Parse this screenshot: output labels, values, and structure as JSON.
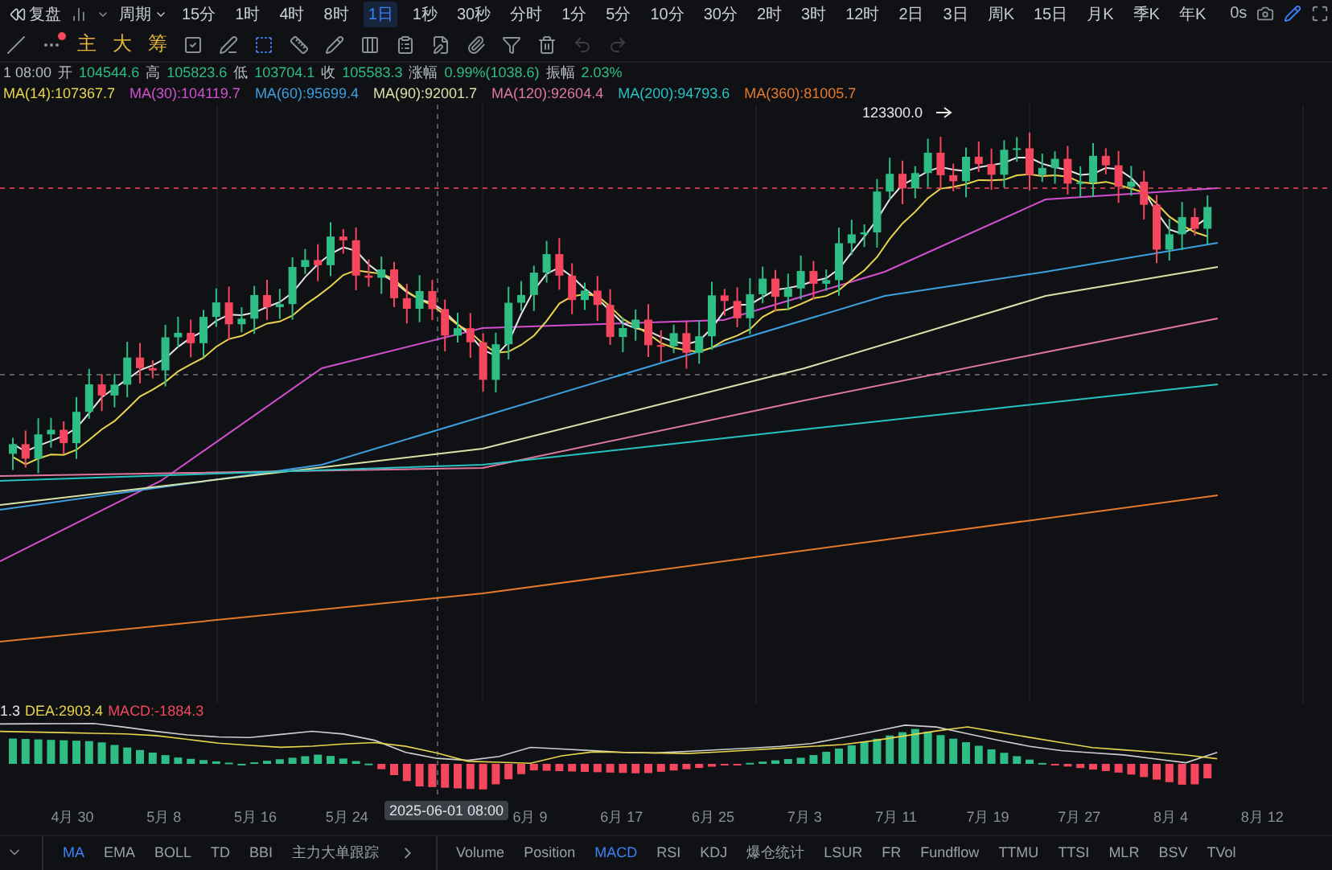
{
  "toolbar": {
    "replay": "复盘",
    "period_menu": "周期",
    "periods": [
      {
        "label": "15分",
        "selected": false
      },
      {
        "label": "1时",
        "selected": false
      },
      {
        "label": "4时",
        "selected": false
      },
      {
        "label": "8时",
        "selected": false
      },
      {
        "label": "1日",
        "selected": true
      },
      {
        "label": "1秒",
        "selected": false
      },
      {
        "label": "30秒",
        "selected": false
      },
      {
        "label": "分时",
        "selected": false
      },
      {
        "label": "1分",
        "selected": false
      },
      {
        "label": "5分",
        "selected": false
      },
      {
        "label": "10分",
        "selected": false
      },
      {
        "label": "30分",
        "selected": false
      },
      {
        "label": "2时",
        "selected": false
      },
      {
        "label": "3时",
        "selected": false
      },
      {
        "label": "12时",
        "selected": false
      },
      {
        "label": "2日",
        "selected": false
      },
      {
        "label": "3日",
        "selected": false
      },
      {
        "label": "周K",
        "selected": false
      },
      {
        "label": "15日",
        "selected": false
      },
      {
        "label": "月K",
        "selected": false
      },
      {
        "label": "季K",
        "selected": false
      },
      {
        "label": "年K",
        "selected": false
      }
    ],
    "countdown": "0s"
  },
  "quick_buttons": [
    "主",
    "大",
    "筹"
  ],
  "ohlc_info": {
    "time": "1 08:00",
    "fields": [
      {
        "label": "开",
        "value": "104544.6"
      },
      {
        "label": "高",
        "value": "105823.6"
      },
      {
        "label": "低",
        "value": "103704.1"
      },
      {
        "label": "收",
        "value": "105583.3"
      },
      {
        "label": "涨幅",
        "value": "0.99%(1038.6)"
      },
      {
        "label": "振幅",
        "value": "2.03%"
      }
    ]
  },
  "ma_legend": [
    {
      "text": "MA(14):107367.7",
      "color": "#e8d44d"
    },
    {
      "text": "MA(30):104119.7",
      "color": "#d24fd0"
    },
    {
      "text": "MA(60):95699.4",
      "color": "#3d9fe0"
    },
    {
      "text": "MA(90):92001.7",
      "color": "#d6e2a6"
    },
    {
      "text": "MA(120):92604.4",
      "color": "#e0789e"
    },
    {
      "text": "MA(200):94793.6",
      "color": "#27c2c2"
    },
    {
      "text": "MA(360):81005.7",
      "color": "#e5792c"
    }
  ],
  "chart": {
    "high_marker": "123300.0",
    "crosshair_time": "2025-06-01 08:00",
    "x_labels": [
      "4月 30",
      "5月 8",
      "5月 16",
      "5月 24",
      "6月 9",
      "6月 17",
      "6月 25",
      "7月 3",
      "7月 11",
      "7月 19",
      "7月 27",
      "8月 4",
      "8月 12"
    ]
  },
  "macd_legend": [
    {
      "text": "1.3",
      "color": "#e6e6e6"
    },
    {
      "text": "DEA:2903.4",
      "color": "#e8d44d"
    },
    {
      "text": "MACD:-1884.3",
      "color": "#f6465d"
    }
  ],
  "main_indicators": [
    {
      "label": "MA",
      "selected": true
    },
    {
      "label": "EMA",
      "selected": false
    },
    {
      "label": "BOLL",
      "selected": false
    },
    {
      "label": "TD",
      "selected": false
    },
    {
      "label": "BBI",
      "selected": false
    },
    {
      "label": "主力大单跟踪",
      "selected": false
    }
  ],
  "sub_indicators": [
    {
      "label": "Volume",
      "selected": false
    },
    {
      "label": "Position",
      "selected": false
    },
    {
      "label": "MACD",
      "selected": true
    },
    {
      "label": "RSI",
      "selected": false
    },
    {
      "label": "KDJ",
      "selected": false
    },
    {
      "label": "爆仓统计",
      "selected": false
    },
    {
      "label": "LSUR",
      "selected": false
    },
    {
      "label": "FR",
      "selected": false
    },
    {
      "label": "Fundflow",
      "selected": false
    },
    {
      "label": "TTMU",
      "selected": false
    },
    {
      "label": "TTSI",
      "selected": false
    },
    {
      "label": "MLR",
      "selected": false
    },
    {
      "label": "BSV",
      "selected": false
    },
    {
      "label": "TVol",
      "selected": false
    }
  ]
}
